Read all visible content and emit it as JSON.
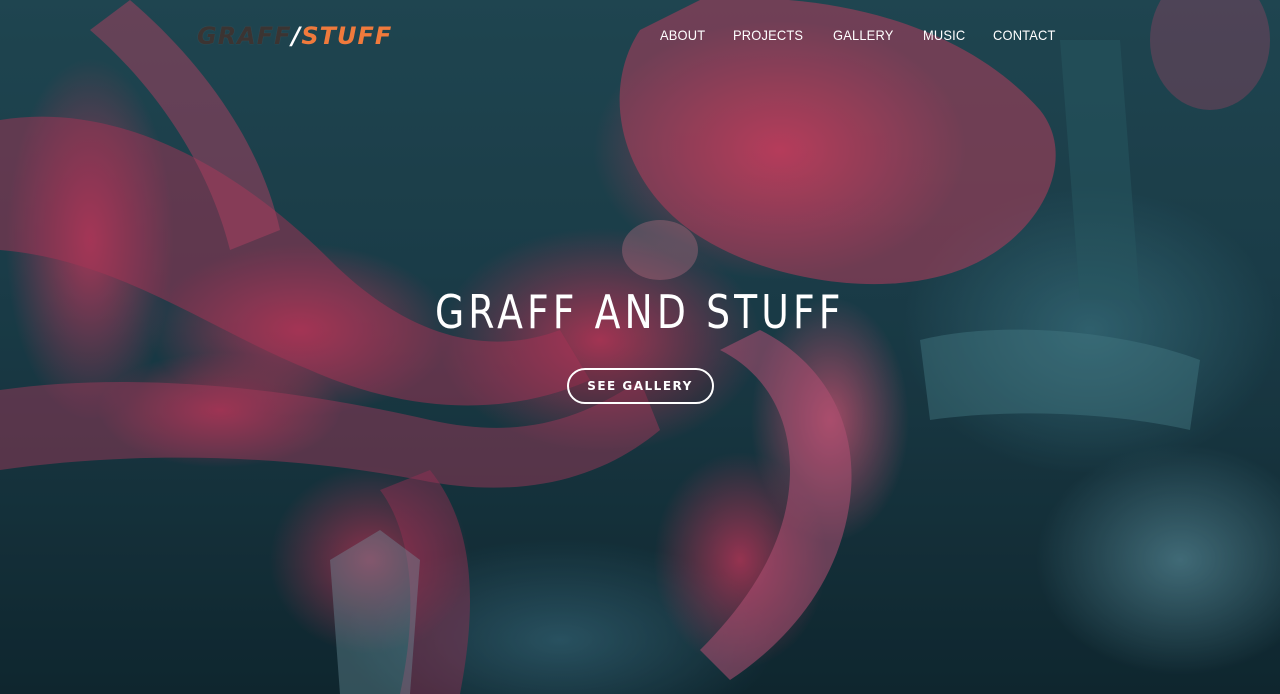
{
  "logo": {
    "part1": "GRAFF",
    "separator": "/",
    "part2": "STUFF"
  },
  "nav": {
    "items": [
      {
        "label": "ABOUT"
      },
      {
        "label": "PROJECTS"
      },
      {
        "label": "GALLERY"
      },
      {
        "label": "MUSIC"
      },
      {
        "label": "CONTACT"
      }
    ]
  },
  "hero": {
    "title": "GRAFF AND STUFF",
    "button_label": "SEE GALLERY",
    "background_image": "octopus-graffiti-mural"
  },
  "colors": {
    "logo_dark": "#3b3432",
    "logo_accent": "#f07a3c",
    "mural_pink": "#e3456b",
    "mural_teal": "#1d4350",
    "text": "#ffffff"
  }
}
